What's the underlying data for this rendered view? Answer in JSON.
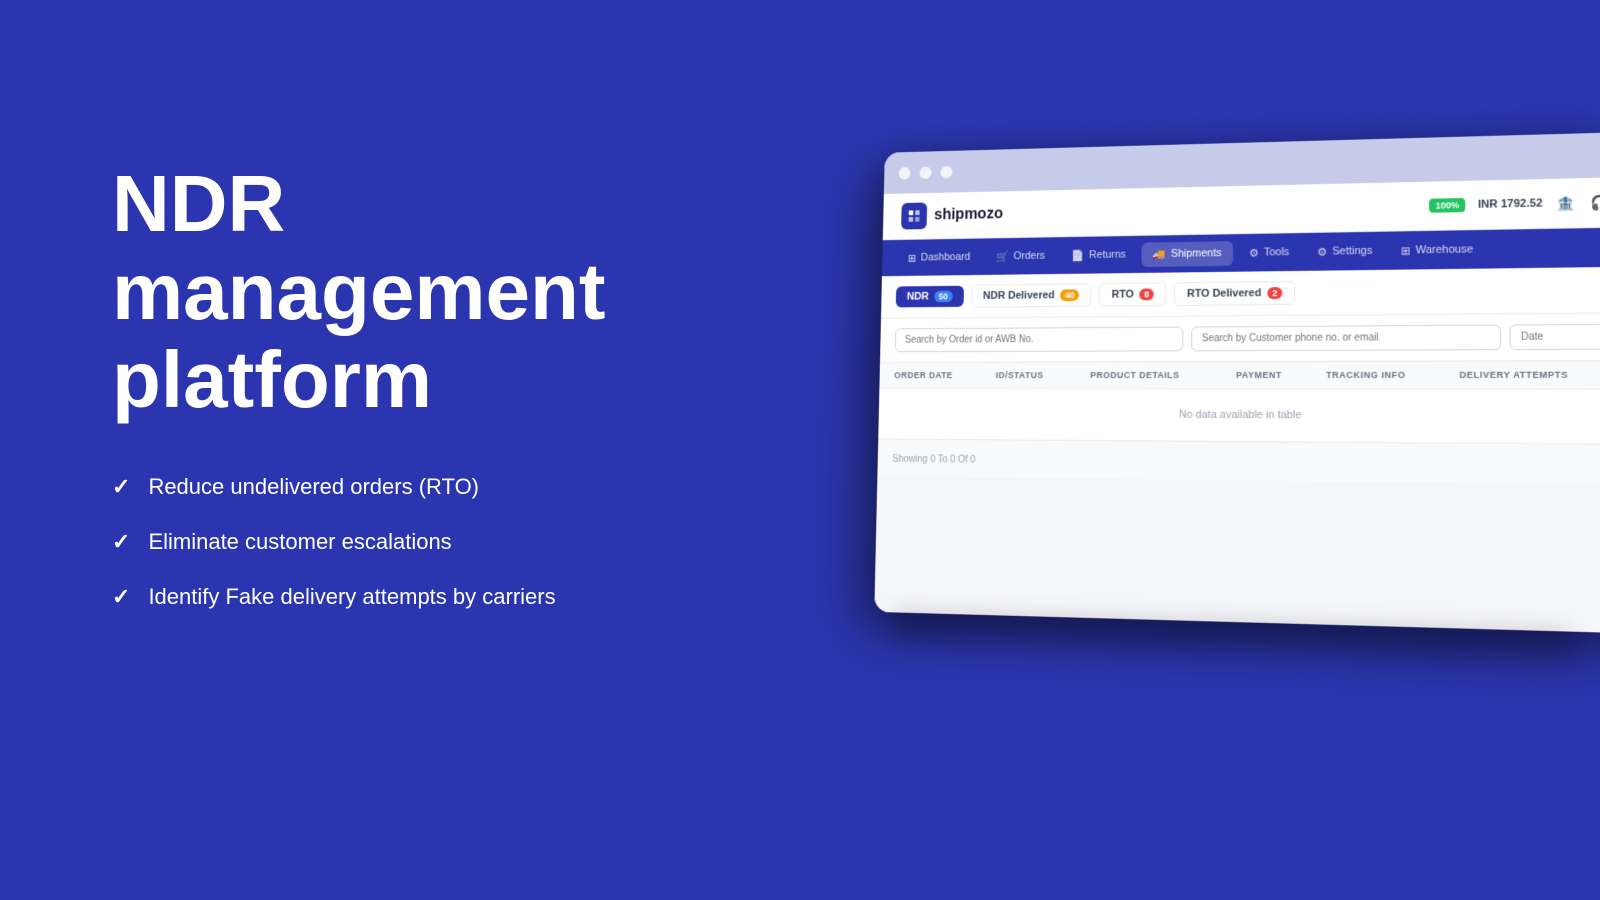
{
  "page": {
    "background_color": "#2b35af"
  },
  "left": {
    "title_line1": "NDR",
    "title_line2": "management",
    "title_line3": "platform",
    "features": [
      {
        "text": "Reduce undelivered orders (RTO)"
      },
      {
        "text": "Eliminate customer escalations"
      },
      {
        "text": "Identify Fake delivery attempts by carriers"
      }
    ]
  },
  "browser": {
    "traffic_lights": [
      "#ffffff",
      "#ffffff",
      "#ffffff"
    ],
    "app": {
      "logo_text": "shipmozo",
      "balance_badge": "100%",
      "balance_amount": "INR 1792.52",
      "nav_items": [
        {
          "label": "Dashboard",
          "icon": "⊞",
          "active": false
        },
        {
          "label": "Orders",
          "icon": "🛒",
          "active": false
        },
        {
          "label": "Returns",
          "icon": "📄",
          "active": false
        },
        {
          "label": "Shipments",
          "icon": "🚚",
          "active": true
        },
        {
          "label": "Tools",
          "icon": "⚙",
          "active": false
        },
        {
          "label": "Settings",
          "icon": "⚙",
          "active": false
        },
        {
          "label": "Warehouse",
          "icon": "⊞",
          "active": false
        }
      ],
      "tabs": [
        {
          "label": "NDR",
          "badge": "50",
          "badge_color": "badge-blue",
          "active": true
        },
        {
          "label": "NDR Delivered",
          "badge": "40",
          "badge_color": "badge-orange",
          "active": false
        },
        {
          "label": "RTO",
          "badge": "8",
          "badge_color": "badge-red",
          "active": false
        },
        {
          "label": "RTO Delivered",
          "badge": "2",
          "badge_color": "badge-red",
          "active": false
        }
      ],
      "search": {
        "placeholder1": "Search by Order id or AWB No.",
        "placeholder2": "Search by Customer phone no. or email",
        "placeholder3": "Date"
      },
      "table": {
        "columns": [
          "ORDER DATE",
          "ID/STATUS",
          "PRODUCT DETAILS",
          "PAYMENT",
          "TRACKING INFO",
          "DELIVERY ATTEMPTS"
        ],
        "empty_message": "No data available in table",
        "footer": "Showing 0 To 0 Of 0"
      }
    }
  }
}
